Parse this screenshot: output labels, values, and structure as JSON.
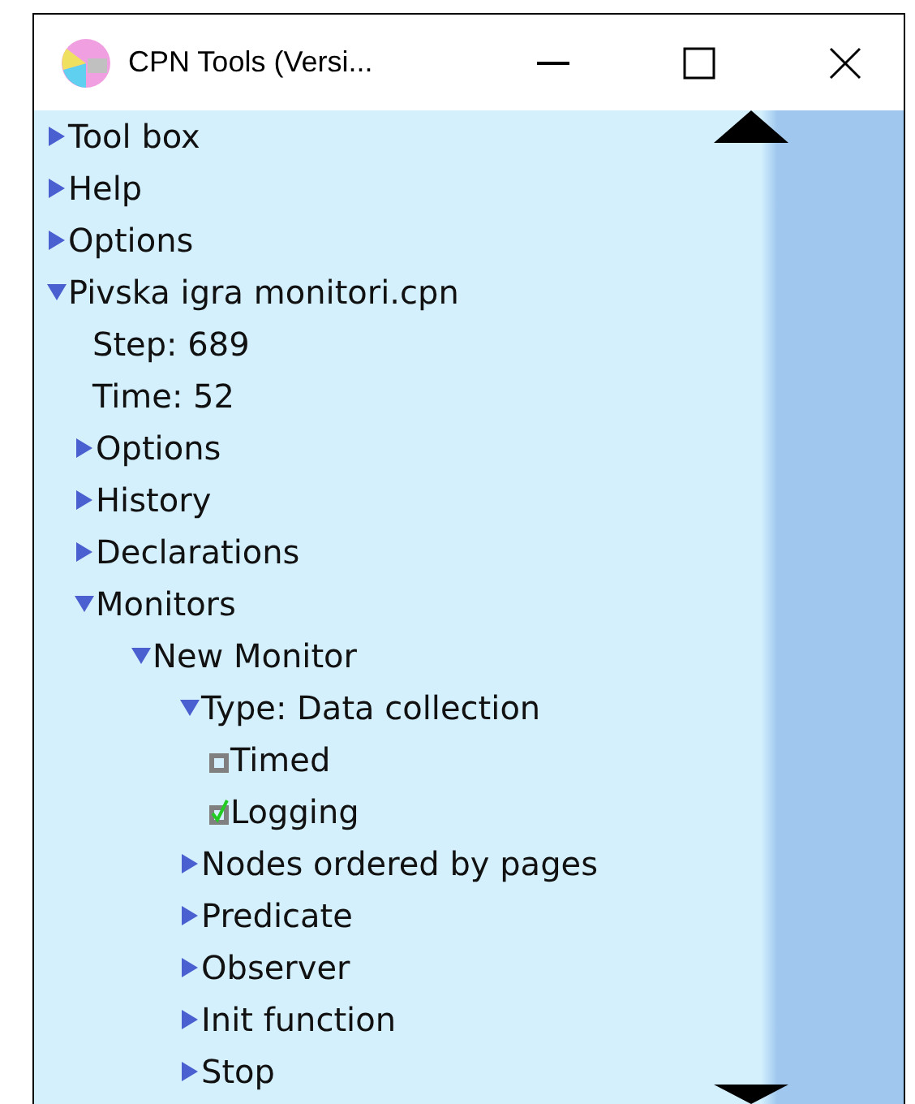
{
  "window": {
    "title": "CPN Tools (Versi..."
  },
  "tree": [
    {
      "kind": "node",
      "label": "Tool box",
      "expanded": false
    },
    {
      "kind": "node",
      "label": "Help",
      "expanded": false
    },
    {
      "kind": "node",
      "label": "Options",
      "expanded": false
    },
    {
      "kind": "node",
      "label": "Pivska igra monitori.cpn",
      "expanded": true,
      "children": [
        {
          "kind": "text",
          "label": "Step: 689"
        },
        {
          "kind": "text",
          "label": "Time: 52"
        },
        {
          "kind": "node",
          "label": "Options",
          "expanded": false
        },
        {
          "kind": "node",
          "label": "History",
          "expanded": false
        },
        {
          "kind": "node",
          "label": "Declarations",
          "expanded": false
        },
        {
          "kind": "node",
          "label": "Monitors",
          "expanded": true,
          "children": [
            {
              "kind": "node",
              "label": "New Monitor",
              "expanded": true,
              "children": [
                {
                  "kind": "node",
                  "label": "Type: Data collection",
                  "expanded": true,
                  "children": [
                    {
                      "kind": "checkbox",
                      "label": "Timed",
                      "checked": false
                    },
                    {
                      "kind": "checkbox",
                      "label": "Logging",
                      "checked": true
                    }
                  ]
                },
                {
                  "kind": "node",
                  "label": "Nodes ordered by pages",
                  "expanded": false
                },
                {
                  "kind": "node",
                  "label": "Predicate",
                  "expanded": false
                },
                {
                  "kind": "node",
                  "label": "Observer",
                  "expanded": false
                },
                {
                  "kind": "node",
                  "label": "Init function",
                  "expanded": false
                },
                {
                  "kind": "node",
                  "label": "Stop",
                  "expanded": false
                }
              ]
            }
          ]
        }
      ]
    }
  ]
}
